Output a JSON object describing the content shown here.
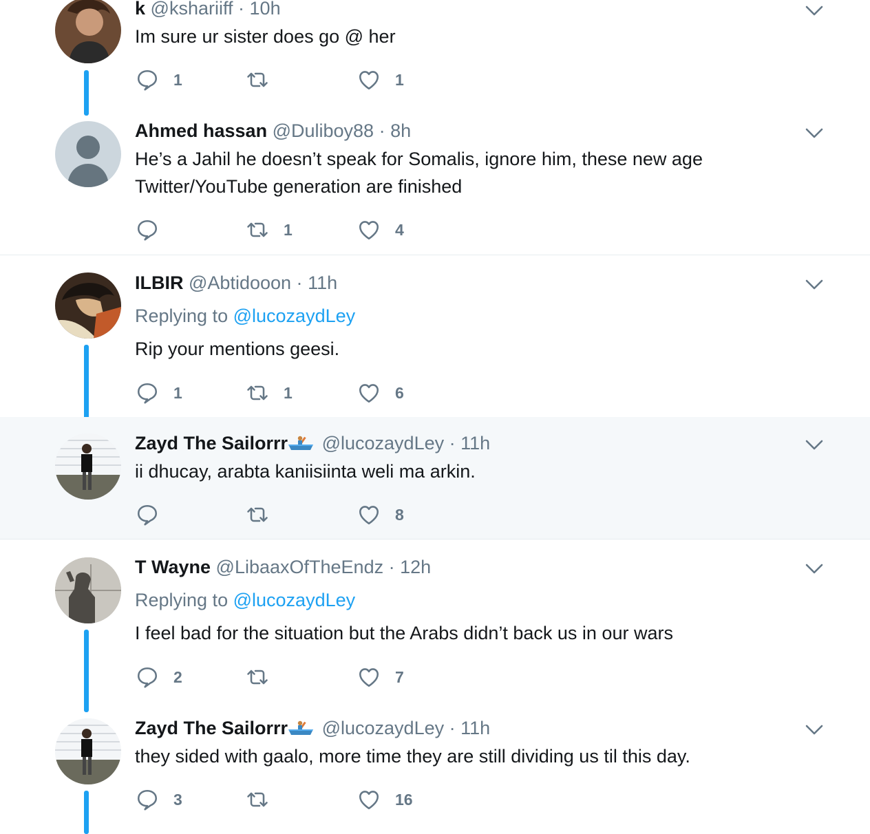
{
  "tweets": [
    {
      "name": "k",
      "handle": "@kshariiff",
      "time": "10h",
      "replying_to": "",
      "text": "Im sure ur sister does go @ her",
      "replies": "1",
      "retweets": "",
      "likes": "1"
    },
    {
      "name": "Ahmed hassan",
      "handle": "@Duliboy88",
      "time": "8h",
      "replying_to": "",
      "text": "He’s a Jahil he doesn’t speak for Somalis, ignore him, these new age Twitter/YouTube generation are finished",
      "replies": "",
      "retweets": "1",
      "likes": "4"
    },
    {
      "name": "ILBIR",
      "handle": "@Abtidooon",
      "time": "11h",
      "replying_to": "@lucozaydLey",
      "text": "Rip your mentions geesi.",
      "replies": "1",
      "retweets": "1",
      "likes": "6"
    },
    {
      "name": "Zayd The Sailorrr",
      "handle": "@lucozaydLey",
      "time": "11h",
      "replying_to": "",
      "text": "ii dhucay, arabta kaniisiinta weli ma arkin.",
      "replies": "",
      "retweets": "",
      "likes": "8"
    },
    {
      "name": "T Wayne",
      "handle": "@LibaaxOfTheEndz",
      "time": "12h",
      "replying_to": "@lucozaydLey",
      "text": "I feel bad for the situation but the Arabs didn’t back us in our wars",
      "replies": "2",
      "retweets": "",
      "likes": "7"
    },
    {
      "name": "Zayd The Sailorrr",
      "handle": "@lucozaydLey",
      "time": "11h",
      "replying_to": "",
      "text": "they sided with gaalo, more time they are still dividing us til this day.",
      "replies": "3",
      "retweets": "",
      "likes": "16"
    }
  ],
  "labels": {
    "replying_prefix": "Replying to",
    "dot": "·"
  },
  "icons": {
    "reply": "reply-icon",
    "retweet": "retweet-icon",
    "like": "heart-icon",
    "more": "chevron-down-icon",
    "rowboat": "rowboat-emoji-icon"
  },
  "colors": {
    "accent": "#1da1f2",
    "muted": "#657786",
    "text": "#14171a",
    "highlight_bg": "#f5f8fa",
    "divider": "#e6ecf0"
  }
}
